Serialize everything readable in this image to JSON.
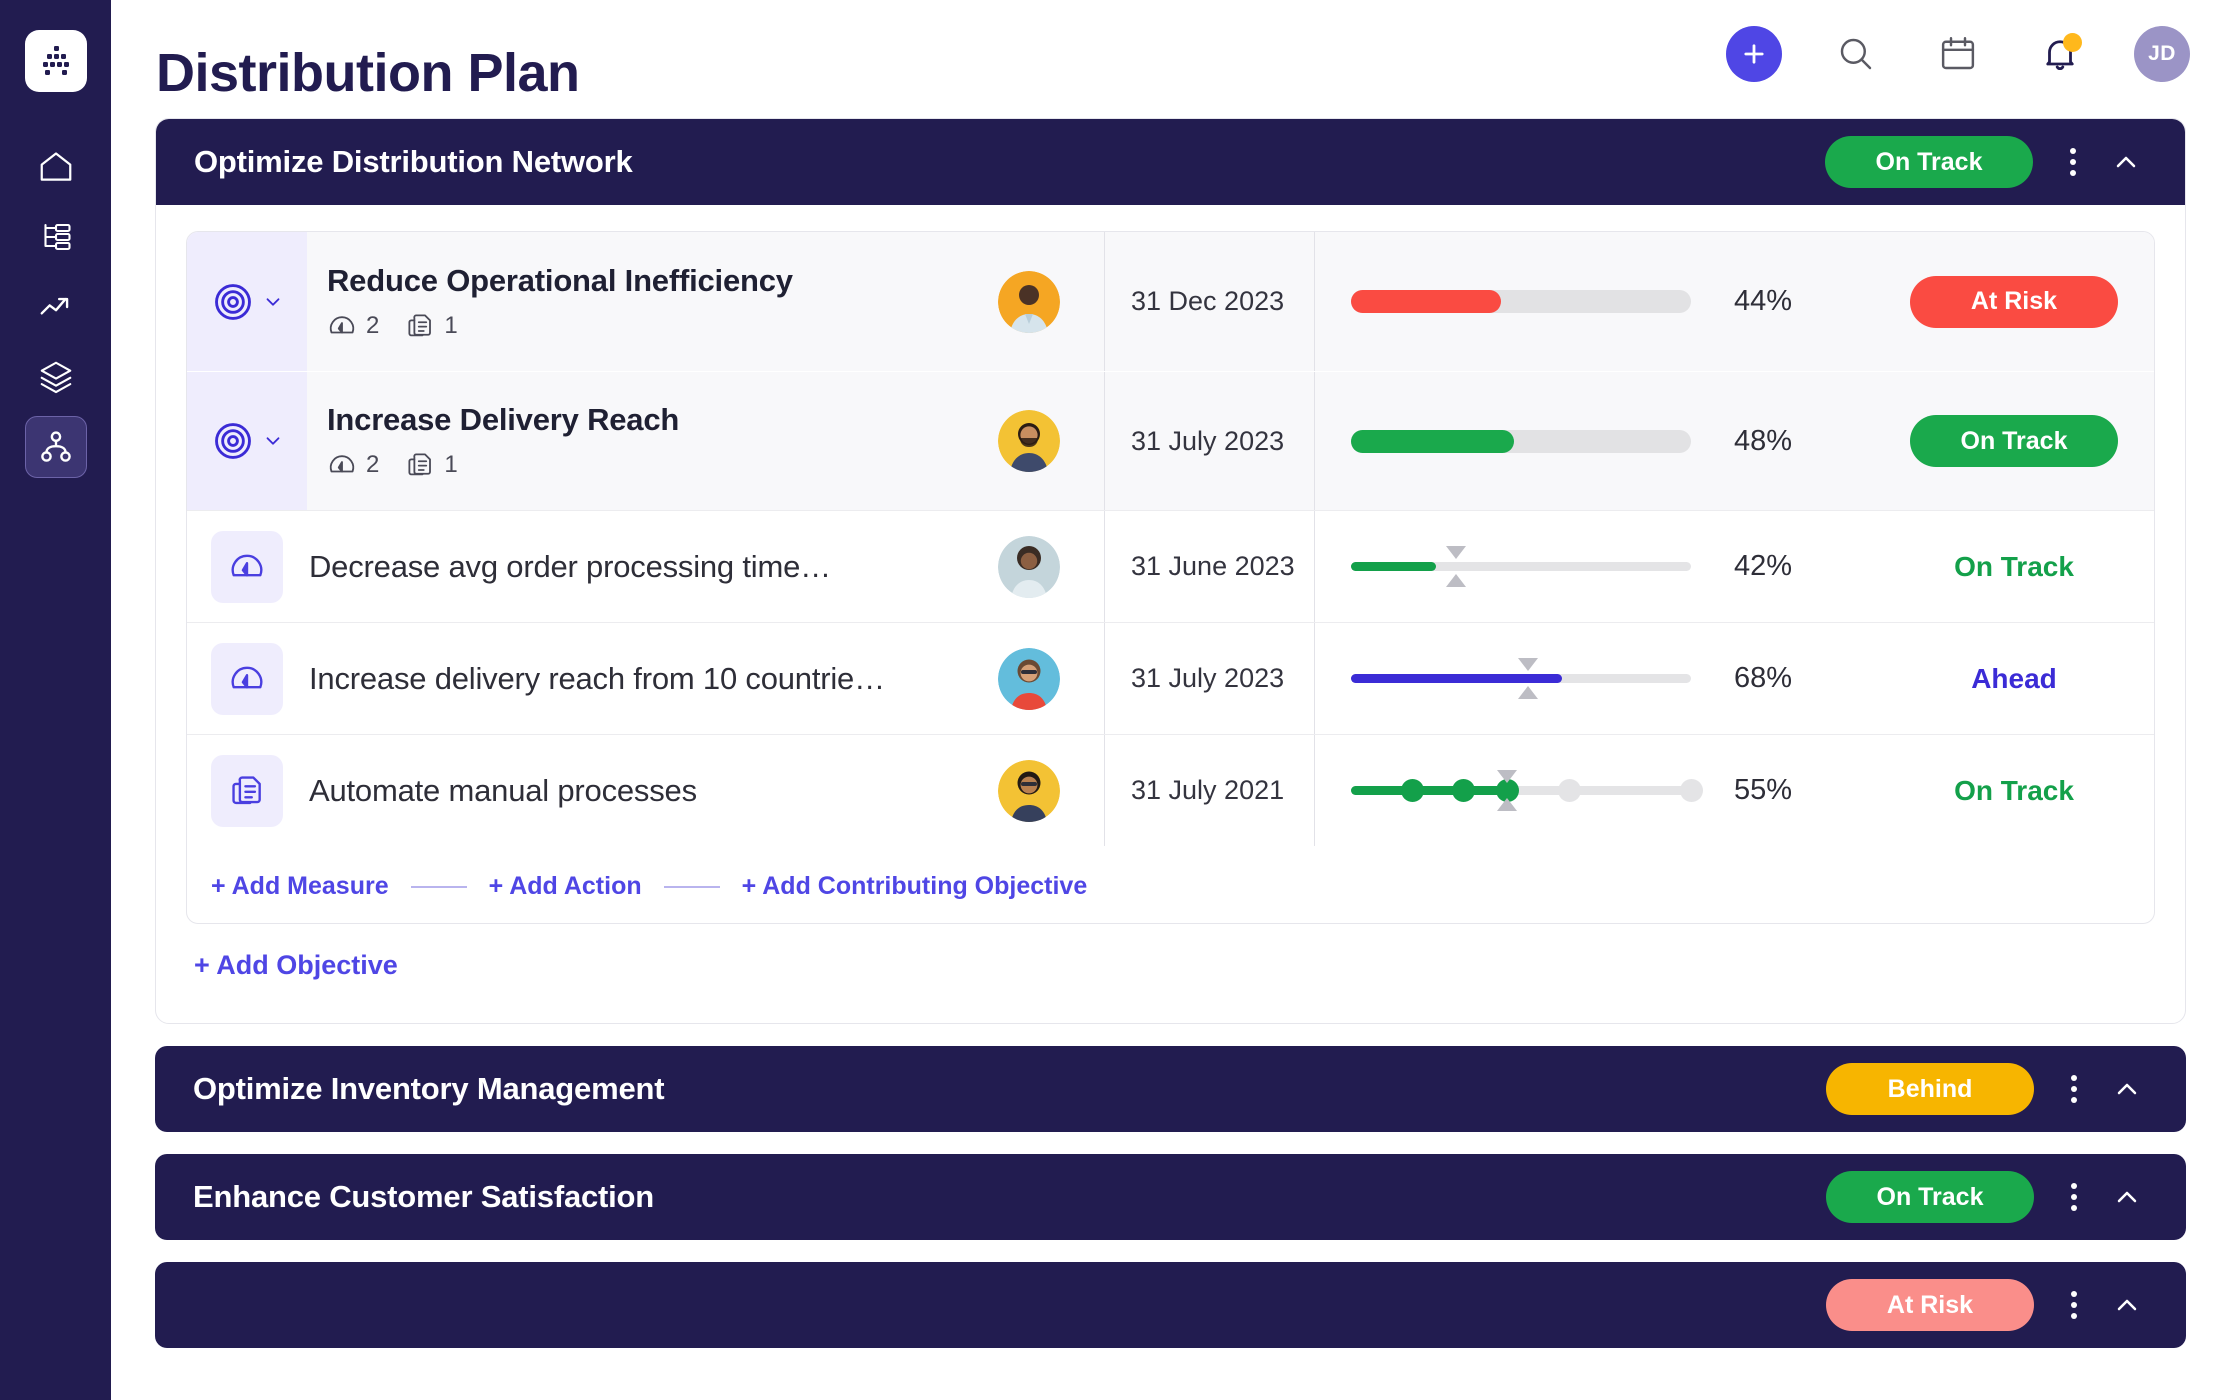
{
  "app": {
    "page_title": "Distribution Plan",
    "accent": "#4F46E5",
    "navy": "#221C50"
  },
  "sidebar": {
    "logo_icon": "network-nodes-logo",
    "items": [
      {
        "icon": "home-icon",
        "name": "home",
        "active": false
      },
      {
        "icon": "org-chart-icon",
        "name": "plans",
        "active": false
      },
      {
        "icon": "trending-up-icon",
        "name": "performance",
        "active": false
      },
      {
        "icon": "layers-icon",
        "name": "layers",
        "active": false
      },
      {
        "icon": "hierarchy-icon",
        "name": "alignment",
        "active": true
      }
    ]
  },
  "topbar": {
    "add_icon": "plus-icon",
    "search_icon": "search-icon",
    "calendar_icon": "calendar-icon",
    "notifications_icon": "bell-icon",
    "notification_dot": true,
    "avatar_initials": "JD"
  },
  "goals": [
    {
      "title": "Optimize Distribution Network",
      "status": "On Track",
      "status_color": "green",
      "expanded": true,
      "menu_icon": "more-vertical-icon",
      "collapse_icon": "chevron-up-icon",
      "rows": [
        {
          "kind": "objective",
          "icon": "target-icon",
          "chevron": "chevron-down-icon",
          "name": "Reduce Operational Inefficiency",
          "measures_icon": "gauge-icon",
          "measures_count": "2",
          "actions_icon": "action-doc-icon",
          "actions_count": "1",
          "avatar_bg": "#F5A623",
          "date": "31 Dec 2023",
          "progress_type": "bar",
          "progress": 44,
          "bar_color": "#FA4B42",
          "percent": "44%",
          "status": "At Risk",
          "status_style": "pill",
          "status_color": "red"
        },
        {
          "kind": "objective",
          "icon": "target-icon",
          "chevron": "chevron-down-icon",
          "name": "Increase Delivery Reach",
          "measures_icon": "gauge-icon",
          "measures_count": "2",
          "actions_icon": "action-doc-icon",
          "actions_count": "1",
          "avatar_bg": "#F3C234",
          "date": "31 July 2023",
          "progress_type": "bar",
          "progress": 48,
          "bar_color": "#1AA94C",
          "percent": "48%",
          "status": "On Track",
          "status_style": "pill",
          "status_color": "green"
        },
        {
          "kind": "measure",
          "icon": "gauge-icon",
          "name": "Decrease avg order processing time…",
          "avatar_bg": "#C4D5DB",
          "date": "31 June 2023",
          "progress_type": "slider",
          "progress": 25,
          "target": 31,
          "bar_color": "#13A04A",
          "percent": "42%",
          "status": "On Track",
          "status_style": "text",
          "status_color": "green"
        },
        {
          "kind": "measure",
          "icon": "gauge-icon",
          "name": "Increase delivery reach from 10 countrie…",
          "avatar_bg": "#63BDDC",
          "date": "31 July 2023",
          "progress_type": "slider",
          "progress": 62,
          "target": 52,
          "bar_color": "#3B2BD6",
          "percent": "68%",
          "status": "Ahead",
          "status_style": "text",
          "status_color": "blue"
        },
        {
          "kind": "action",
          "icon": "action-doc-icon",
          "name": "Automate manual processes",
          "avatar_bg": "#F3C234",
          "date": "31 July 2021",
          "progress_type": "milestones",
          "progress": 46,
          "target": 46,
          "bar_color": "#13A04A",
          "milestones": [
            18,
            33,
            46,
            64,
            100
          ],
          "milestones_done": 3,
          "percent": "55%",
          "status": "On Track",
          "status_style": "text",
          "status_color": "green"
        }
      ],
      "add_links": [
        "+ Add Measure",
        "+ Add Action",
        "+ Add Contributing Objective"
      ],
      "add_objective_label": "+ Add Objective"
    },
    {
      "title": "Optimize Inventory Management",
      "status": "Behind",
      "status_color": "amber",
      "expanded": false,
      "menu_icon": "more-vertical-icon",
      "collapse_icon": "chevron-up-icon"
    },
    {
      "title": "Enhance Customer Satisfaction",
      "status": "On Track",
      "status_color": "green",
      "expanded": false,
      "menu_icon": "more-vertical-icon",
      "collapse_icon": "chevron-up-icon"
    },
    {
      "title": "",
      "status": "At Risk",
      "status_color": "pink",
      "expanded": false,
      "menu_icon": "more-vertical-icon",
      "collapse_icon": "chevron-up-icon"
    }
  ]
}
